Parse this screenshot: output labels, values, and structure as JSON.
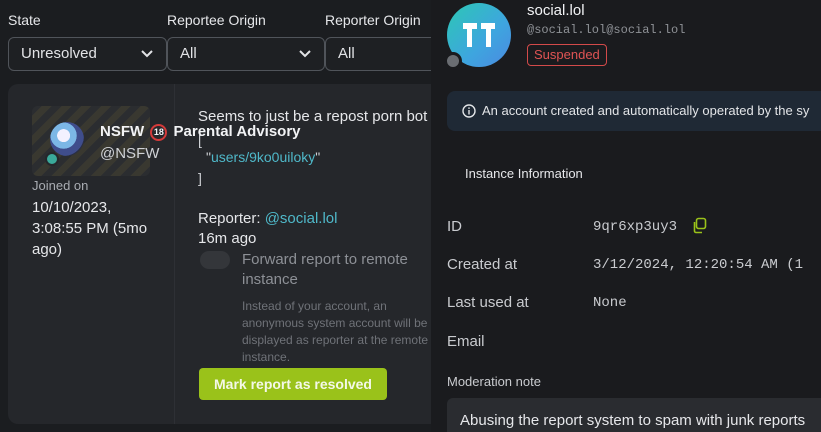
{
  "filters": {
    "state": {
      "label": "State",
      "value": "Unresolved"
    },
    "reportee_origin": {
      "label": "Reportee Origin",
      "value": "All"
    },
    "reporter_origin": {
      "label": "Reporter Origin",
      "value": "All"
    }
  },
  "report": {
    "reportee": {
      "name_a": "NSFW",
      "badge": "18",
      "name_b": "Parental Advisory",
      "handle": "@NSFW",
      "joined_label": "Joined on",
      "joined_value": "10/10/2023, 3:08:55 PM (5mo ago)"
    },
    "comment": "Seems to just be a repost porn bot",
    "code_open": "[",
    "code_item_prefix": "\"",
    "code_item_link": "users/9ko0uiloky",
    "code_item_suffix": "\"",
    "code_close": "]",
    "reporter_label": "Reporter: ",
    "reporter_link": "@social.lol",
    "time_ago": "16m ago",
    "forward_label": "Forward report to remote instance",
    "forward_description": "Instead of your account, an anonymous system account will be displayed as reporter at the remote instance.",
    "resolve_button": "Mark report as resolved"
  },
  "account": {
    "name": "social.lol",
    "acct": "@social.lol@social.lol",
    "status_badge": "Suspended",
    "notice": "An account created and automatically operated by the sy",
    "section_button": "Instance Information",
    "rows": [
      {
        "label": "ID",
        "value": "9qr6xp3uy3"
      },
      {
        "label": "Created at",
        "value": "3/12/2024, 12:20:54 AM (1"
      },
      {
        "label": "Last used at",
        "value": "None"
      },
      {
        "label": "Email",
        "value": ""
      }
    ],
    "moderation_note_label": "Moderation note",
    "moderation_note": "Abusing the report system to spam with junk reports"
  },
  "colors": {
    "accent": "#9ac21a",
    "link": "#4fb8c9",
    "danger": "#e05454",
    "copy_icon": "#9ac21a"
  },
  "icons": {
    "select_chevron": "chevron-down-icon",
    "info": "info-icon",
    "copy": "copy-icon",
    "instance_logo": "instance-logo-icon"
  }
}
